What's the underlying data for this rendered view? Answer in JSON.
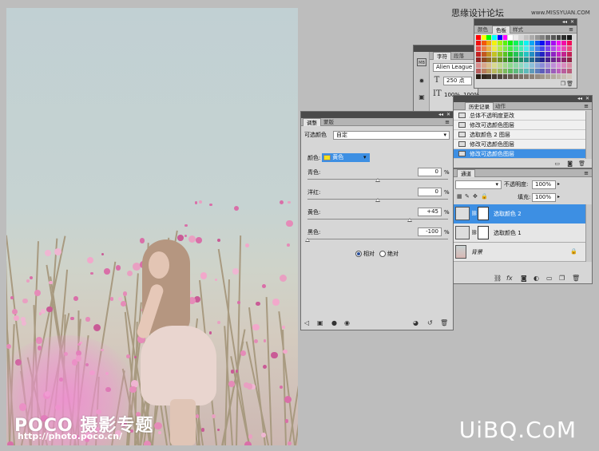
{
  "credit": {
    "text": "思缘设计论坛",
    "url": "www.MISSYUAN.COM"
  },
  "watermark": "UiBQ.CoM",
  "photo": {
    "logo": "POCO 摄影专题",
    "url": "http://photo.poco.cn/"
  },
  "color_panel": {
    "tabs": [
      "颜色",
      "色板",
      "样式"
    ],
    "active_tab": "色板"
  },
  "char_panel": {
    "tabs": [
      "字符",
      "段落"
    ],
    "font": "Alien League",
    "size": "250 点",
    "scale_v": "100%",
    "scale_h": "100%"
  },
  "history_panel": {
    "tabs": [
      "历史记录",
      "动作"
    ],
    "items": [
      "总体不透明度更改",
      "修改可选颜色图层",
      "选取颜色 2 图层",
      "修改可选颜色图层",
      "修改可选颜色图层"
    ],
    "selected_index": 4
  },
  "layers_panel": {
    "tab": "通道",
    "opacity_label": "不透明度:",
    "opacity": "100%",
    "fill_label": "填充:",
    "fill": "100%",
    "layers": [
      {
        "name": "选取颜色 2",
        "selected": true
      },
      {
        "name": "选取颜色 1",
        "selected": false
      },
      {
        "name": "背景",
        "selected": false
      }
    ]
  },
  "adjust_panel": {
    "tabs": [
      "调整",
      "蒙版"
    ],
    "active_tab": "调整",
    "type_label": "可选颜色",
    "preset": "自定",
    "color_label": "颜色:",
    "color_value": "黄色",
    "color_swatch": "#f5e21a",
    "sliders": [
      {
        "label": "青色:",
        "value": "0",
        "unit": "%",
        "pos": 0.5
      },
      {
        "label": "洋红:",
        "value": "0",
        "unit": "%",
        "pos": 0.5
      },
      {
        "label": "黄色:",
        "value": "+45",
        "unit": "%",
        "pos": 0.725
      },
      {
        "label": "黑色:",
        "value": "-100",
        "unit": "%",
        "pos": 0.0
      }
    ],
    "mode_relative": "相对",
    "mode_absolute": "绝对",
    "mode_selected": "相对"
  },
  "colors": {
    "selection": "#3d8fe3",
    "panel_dark": "#4a4a4a"
  }
}
